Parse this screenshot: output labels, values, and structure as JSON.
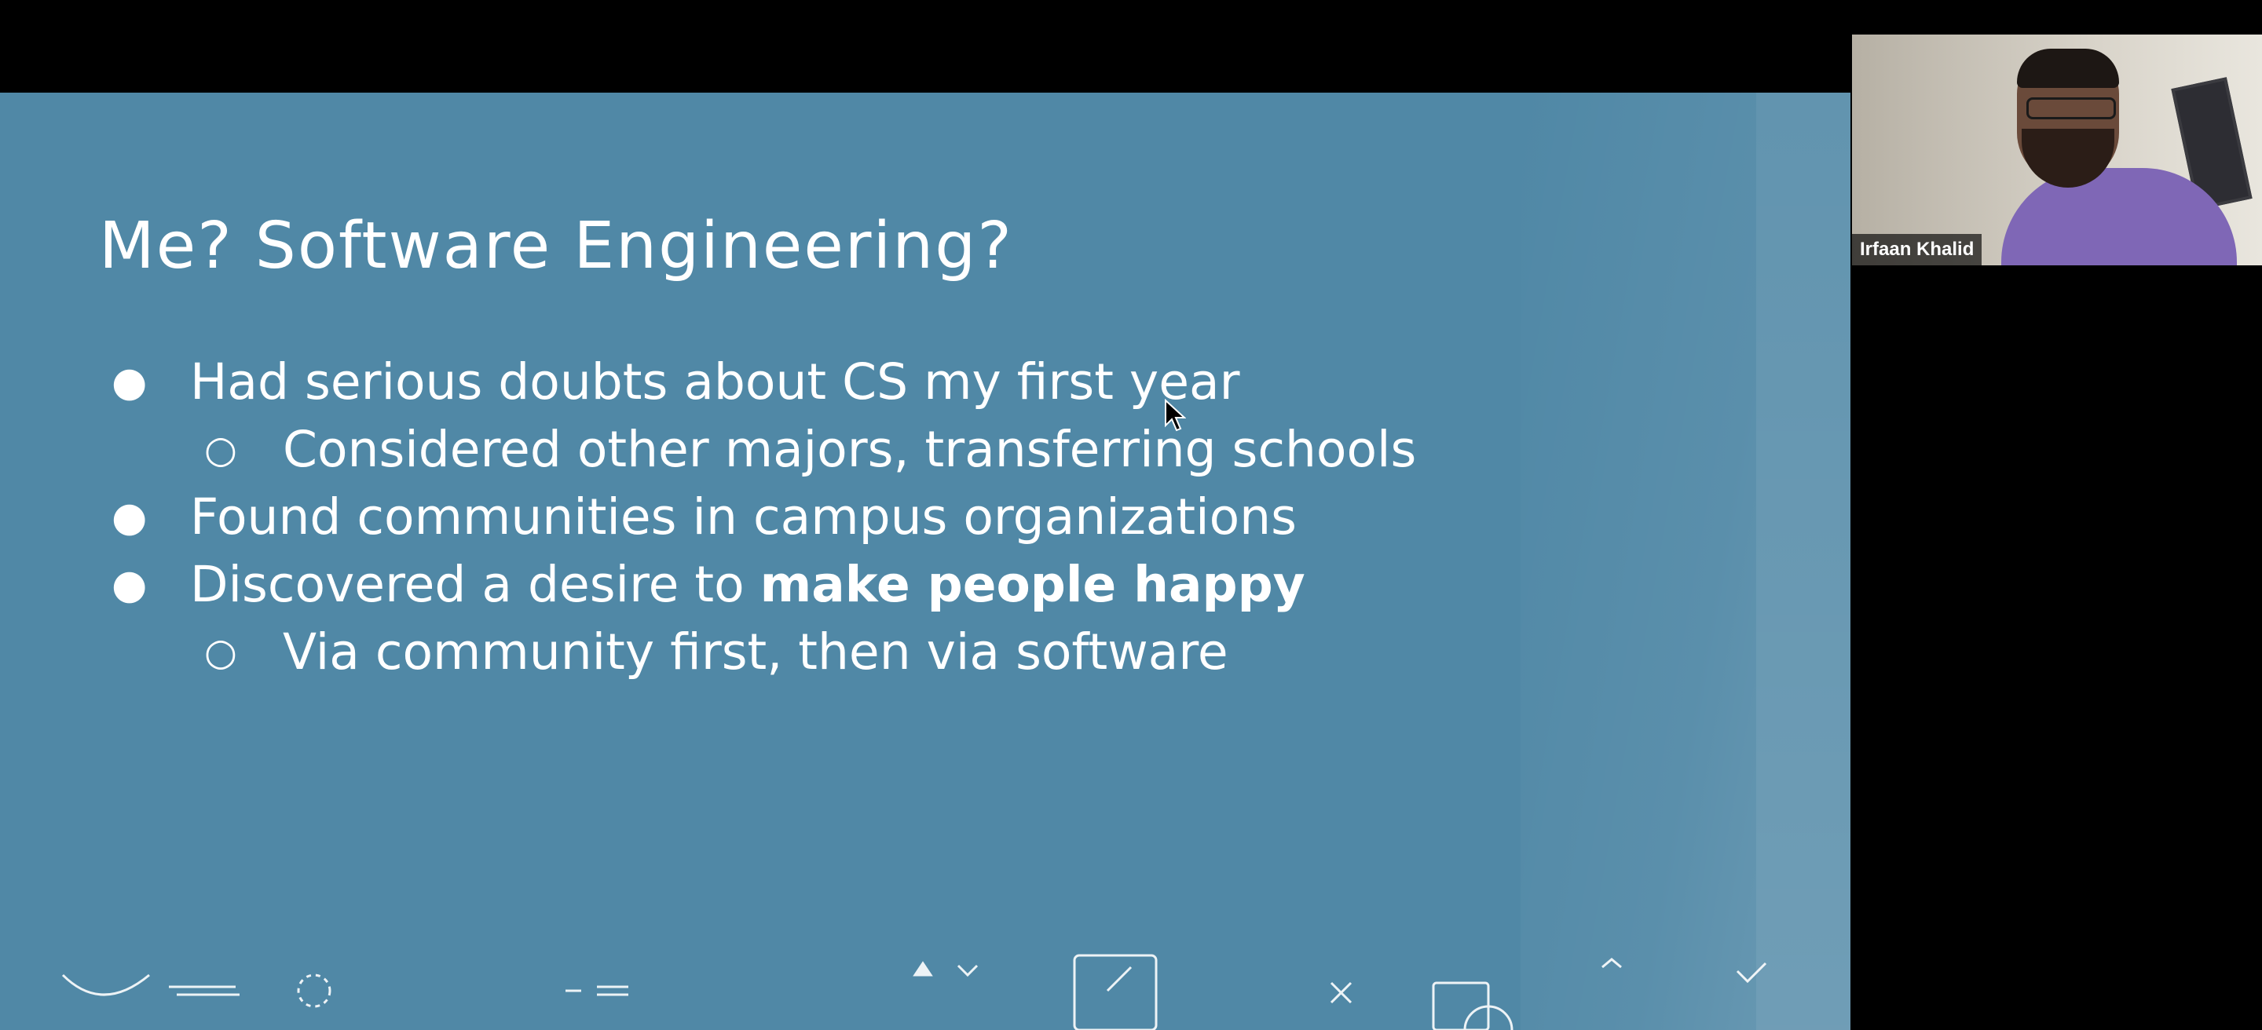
{
  "slide": {
    "title": "Me? Software Engineering?",
    "bullets": [
      {
        "level": 1,
        "marker": "●",
        "text": "Had serious doubts about CS my first year"
      },
      {
        "level": 2,
        "marker": "○",
        "text": "Considered other majors, transferring schools"
      },
      {
        "level": 1,
        "marker": "●",
        "text": "Found communities in campus organizations"
      },
      {
        "level": 1,
        "marker": "●",
        "text_prefix": "Discovered a desire to ",
        "text_bold": "make people happy"
      },
      {
        "level": 2,
        "marker": "○",
        "text": "Via community first, then via software"
      }
    ],
    "colors": {
      "background": "#5088a6",
      "text": "#ffffff"
    }
  },
  "video": {
    "participant_name": "Irfaan Khalid"
  }
}
